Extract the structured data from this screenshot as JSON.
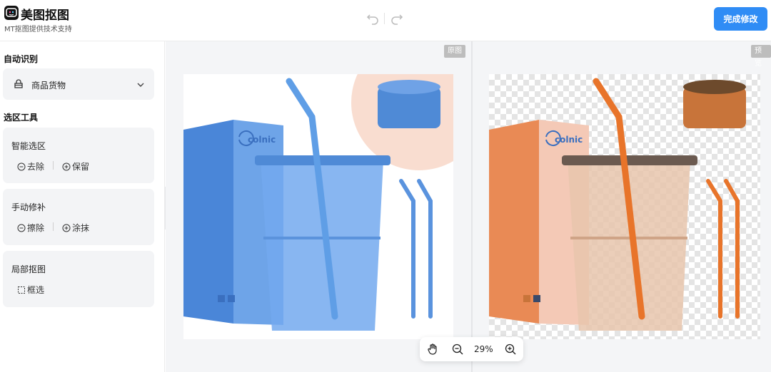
{
  "header": {
    "app_title": "美图抠图",
    "subtitle": "MT抠图提供技术支持",
    "done_label": "完成修改"
  },
  "sidebar": {
    "auto_section": "自动识别",
    "category_value": "商品货物",
    "tools_section": "选区工具",
    "smart": {
      "title": "智能选区",
      "remove": "去除",
      "keep": "保留"
    },
    "manual": {
      "title": "手动修补",
      "erase": "擦除",
      "paint": "涂抹"
    },
    "local": {
      "title": "局部抠图",
      "box": "框选"
    }
  },
  "canvas": {
    "original_tag": "原图",
    "preview_tag": "预览",
    "brand_text": "colnic",
    "zoom": "29%"
  },
  "colors": {
    "accent": "#2f8cf5",
    "product_blue": "#5f9ee6",
    "product_amber": "#c8743a"
  },
  "icons": [
    "undo-icon",
    "redo-icon",
    "bag-icon",
    "chevron-down-icon",
    "minus-circle-icon",
    "plus-circle-icon",
    "marquee-icon",
    "chevron-left-icon",
    "hand-icon",
    "zoom-out-icon",
    "zoom-in-icon"
  ]
}
